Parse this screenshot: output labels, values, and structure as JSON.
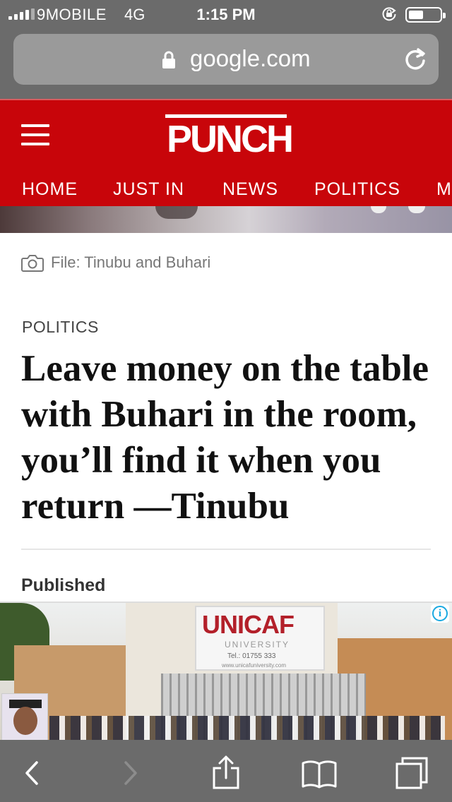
{
  "status_bar": {
    "carrier": "9MOBILE",
    "network": "4G",
    "time": "1:15 PM"
  },
  "url_bar": {
    "domain": "google.com"
  },
  "site": {
    "logo": "PUNCH",
    "brand_color": "#c8050a",
    "nav": [
      "HOME",
      "JUST IN",
      "NEWS",
      "POLITICS",
      "M"
    ]
  },
  "article": {
    "image_caption": "File: Tinubu and Buhari",
    "category": "POLITICS",
    "headline": "Leave money on the table with Buhari in the room, you’ll find it when you return —Tinubu",
    "published_label": "Published"
  },
  "ad": {
    "brand": "UNICAF",
    "sub": "UNIVERSITY",
    "tel": "Tel.: 01755 333",
    "web": "www.unicafuniversity.com",
    "info_glyph": "i"
  },
  "toolbar": {
    "icons": [
      "back-icon",
      "forward-icon",
      "share-icon",
      "bookmarks-icon",
      "tabs-icon"
    ]
  }
}
